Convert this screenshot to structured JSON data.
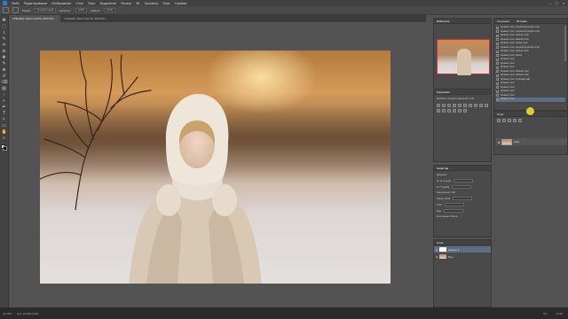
{
  "menubar": {
    "items": [
      "Файл",
      "Редактирование",
      "Изображение",
      "Слои",
      "Текст",
      "Выделение",
      "Фильтр",
      "3D",
      "Просмотр",
      "Окно",
      "Справка"
    ],
    "window_controls": [
      "–",
      "□",
      "×"
    ]
  },
  "optbar": {
    "fields": [
      "Нормальный",
      "100%",
      "100%"
    ],
    "labels": [
      "Режим:",
      "Непрозр.:",
      "Нажим:"
    ]
  },
  "tabs": [
    {
      "label": "ТРЕНИНГ-2022 И ЕСТЬ ЗОЛОТО ...",
      "active": true
    },
    {
      "label": "ТРЕНИНГ-2022 И ЕСТЬ ЗОЛОТО ...",
      "active": false
    }
  ],
  "toolbar": {
    "tools": [
      "move-tool",
      "marquee-tool",
      "lasso-tool",
      "quick-select-tool",
      "crop-tool",
      "eyedropper-tool",
      "healing-tool",
      "brush-tool",
      "stamp-tool",
      "history-brush-tool",
      "eraser-tool",
      "gradient-tool",
      "blur-tool",
      "dodge-tool",
      "pen-tool",
      "type-tool",
      "path-select-tool",
      "shape-tool",
      "hand-tool",
      "zoom-tool"
    ],
    "tool_glyphs": [
      "✥",
      "⬚",
      "ℓ",
      "✎",
      "⌗",
      "⊘",
      "✚",
      "✎",
      "⊕",
      "↺",
      "⌫",
      "▤",
      "◌",
      "◐",
      "✒",
      "T",
      "↖",
      "▭",
      "✋",
      "⌕"
    ]
  },
  "panels": {
    "navigator": {
      "title": "Навигатор",
      "zoom": "24%"
    },
    "history": {
      "tabs": [
        "Операции",
        "История"
      ],
      "rows": [
        "Кривые слоя, корректирующий слой",
        "Кривые слоя, корректирующий слой",
        "Кривые слоя, Новый слой",
        "Кривые слоя, Новый слой",
        "Кривые слоя, маска слоя",
        "Кривые слоя, корректирующий слой",
        "Кривые слоя, Новый слой",
        "Кривые слоя, маска",
        "Кривые слоя",
        "Кривые слоя",
        "Кривые слоя",
        "Кривые слоя, Новый слой",
        "Кривые слоя, Новый слой",
        "Кривые слоя, Стандартный",
        "Кривые слоя",
        "Кривые слоя",
        "Кривые слоя",
        "Кривые слоя",
        "Кривые слоя"
      ],
      "selected_index": 18
    },
    "properties": {
      "title": "Коррекция",
      "subtitle": "Добавить корректирующий слой"
    },
    "layers_top": {
      "title": "Слои",
      "layer_name": "Фон"
    },
    "adjust": {
      "title": "Свойства",
      "lines": [
        "Документ",
        "Ш: 11.4 дюйм",
        "В: 7.6 дюйм",
        "Разрешение: 240",
        "Режим: RGB",
        "8 бит",
        "Фон"
      ],
      "checkbox": "Монтажная область"
    },
    "layers": {
      "title": "Слои",
      "rows": [
        "Кривые 1",
        "Фон"
      ]
    }
  },
  "statusbar": {
    "zoom": "24.45%",
    "doc": "Док: 29,9M/29,9M",
    "right": [
      "RU",
      "10:45"
    ]
  }
}
